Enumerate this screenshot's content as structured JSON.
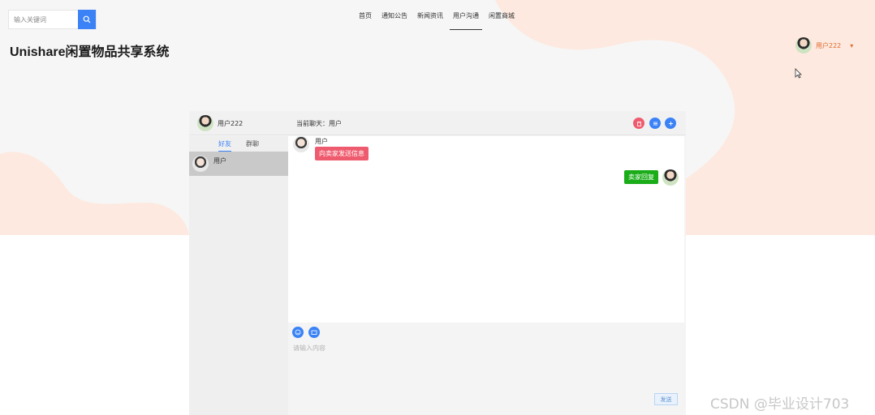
{
  "search": {
    "placeholder": "输入关键词"
  },
  "nav": {
    "items": [
      {
        "label": "首页"
      },
      {
        "label": "通知公告"
      },
      {
        "label": "新闻资讯"
      },
      {
        "label": "用户沟通"
      },
      {
        "label": "闲置商城"
      }
    ],
    "active_label": "用户沟通"
  },
  "site": {
    "title": "Unishare闲置物品共享系统"
  },
  "top_user": {
    "name": "用户222"
  },
  "chat": {
    "me_name": "用户222",
    "current_chat_label": "当前聊天：用户",
    "tabs": {
      "friends": "好友",
      "groups": "群聊"
    },
    "contacts": [
      {
        "name": "用户"
      }
    ],
    "messages": [
      {
        "sender": "用户",
        "text": "向卖家发送信息",
        "side": "left"
      },
      {
        "text": "卖家回复",
        "side": "right"
      }
    ],
    "input_placeholder": "请输入内容",
    "send_label": "发送"
  },
  "colors": {
    "accent": "#3b82f6",
    "bubble_left": "#ef5b6e",
    "bubble_right": "#1aad19",
    "header_btn_red": "#ef5b6e",
    "header_btn_blue": "#3b82f6",
    "username_orange": "#e06a2c",
    "blob": "#fde9df"
  },
  "watermark": "CSDN @毕业设计703"
}
